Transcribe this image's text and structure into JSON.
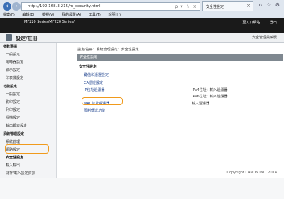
{
  "browser": {
    "url": "http://192.168.3.215/m_security.html",
    "url_icons": "ρ ▾ ☆ ×",
    "tab_title": "安全性設定",
    "win_icons": "⌂ ☆ ⚙",
    "menu": [
      "檔案(F)",
      "編輯(E)",
      "檢視(V)",
      "我的最愛(A)",
      "工具(T)",
      "說明(H)"
    ]
  },
  "header": {
    "model": "MF220 Series/MF220 Series/",
    "links": [
      "至入口網站",
      "登出"
    ],
    "page_title": "設定/註冊",
    "mgr": "安全管理員編號"
  },
  "sidebar": {
    "groups": [
      {
        "head": "參數選擇",
        "items": [
          "一般設定",
          "定時器設定",
          "顯示設定",
          "印表機設定"
        ]
      },
      {
        "head": "功能設定",
        "items": [
          "一般設定",
          "影印設定",
          "列印設定",
          "掃描設定",
          "輸出報表設定"
        ]
      },
      {
        "head": "系統管理設定",
        "items": [
          "系統管理",
          "網路設定",
          "安全性設定",
          "輸入輸出",
          "儲存/載入設定資訊"
        ]
      }
    ]
  },
  "main": {
    "breadcrumb": "設定/註冊：系統管理設定：安全性設定",
    "section": "安全性設定",
    "subsection": "安全性設定",
    "rows": [
      {
        "link": "鍵值和憑證設定",
        "desc": ""
      },
      {
        "link": "CA憑證設定",
        "desc": ""
      },
      {
        "link": "IP位址過濾器",
        "desc": "IPv4位址：輸入過濾器"
      },
      {
        "link": "",
        "desc": "IPv6位址：輸入過濾器"
      },
      {
        "link": "MAC位址過濾器",
        "desc": "輸入過濾器"
      },
      {
        "link": "限制傳送功能",
        "desc": ""
      }
    ],
    "copyright": "Copyright CANON INC. 2014"
  }
}
